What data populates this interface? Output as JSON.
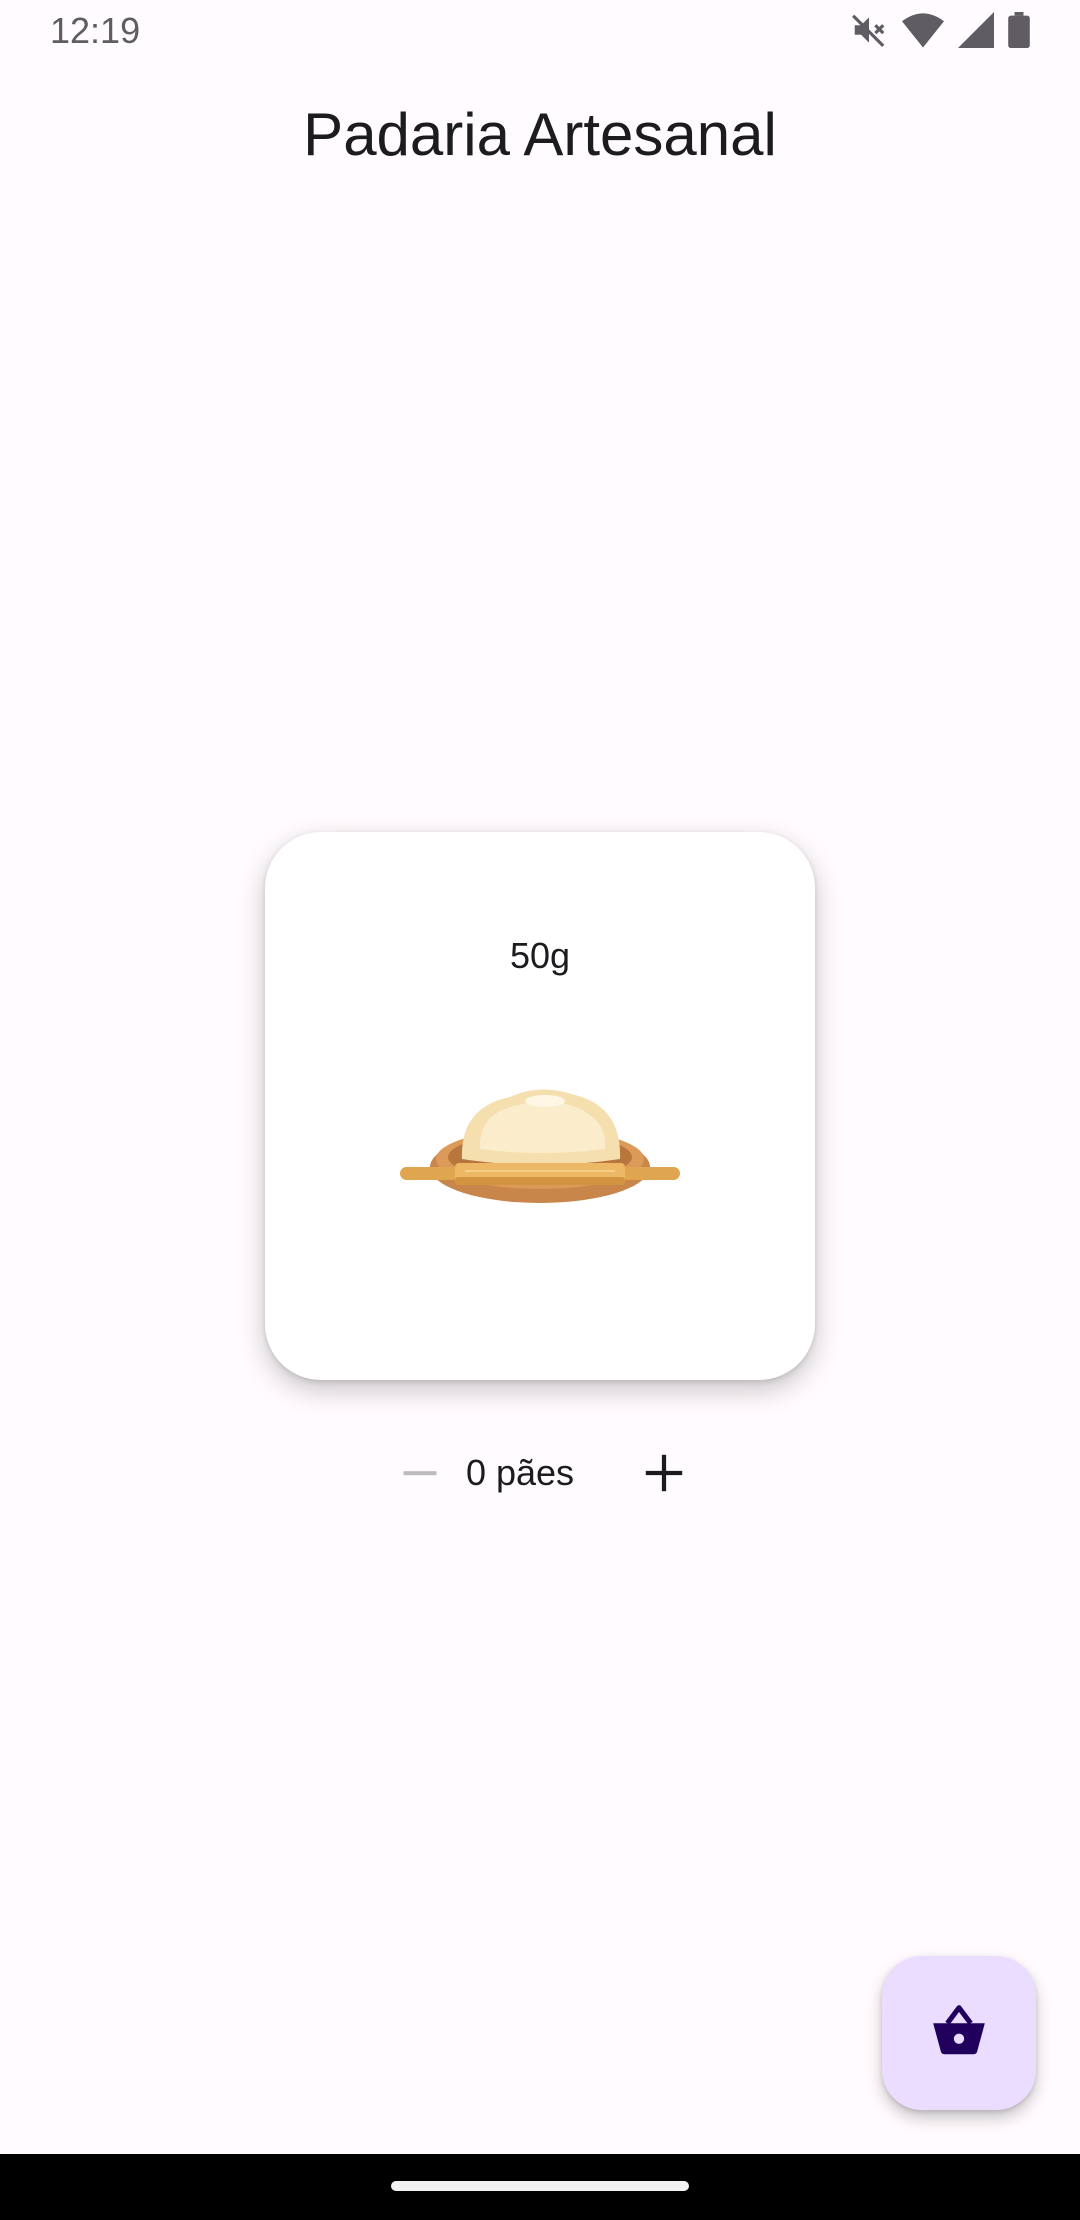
{
  "status_bar": {
    "time": "12:19",
    "icons": [
      "mute-icon",
      "wifi-icon",
      "signal-icon",
      "battery-icon"
    ]
  },
  "app": {
    "title": "Padaria Artesanal"
  },
  "product": {
    "weight": "50g",
    "image": "dough-on-board-image"
  },
  "quantity": {
    "label": "0 pães",
    "decrement_icon": "minus-icon",
    "increment_icon": "plus-icon"
  },
  "fab": {
    "icon": "basket-icon"
  },
  "colors": {
    "background": "#fffbfe",
    "fab_background": "#eaddff",
    "fab_icon": "#21005d",
    "text": "#1c1b1f",
    "disabled_icon": "#bdbbc0"
  }
}
